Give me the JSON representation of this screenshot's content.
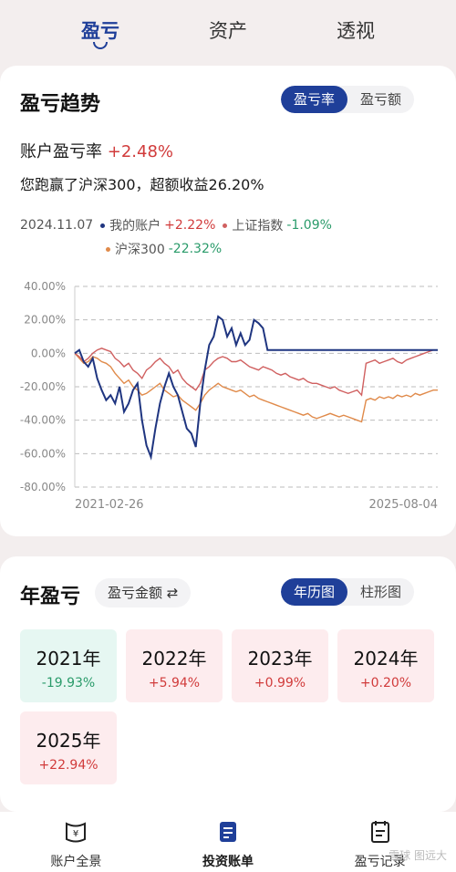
{
  "top_tabs": [
    {
      "label": "盈亏",
      "active": true
    },
    {
      "label": "资产",
      "active": false
    },
    {
      "label": "透视",
      "active": false
    }
  ],
  "trend": {
    "title": "盈亏趋势",
    "seg": [
      "盈亏率",
      "盈亏额"
    ],
    "account_label": "账户盈亏率",
    "account_value": "+2.48%",
    "beat_text": "您跑赢了沪深300，超额收益26.20%",
    "legend": {
      "date": "2024.11.07",
      "mine_label": "我的账户",
      "mine_value": "+2.22%",
      "sse_label": "上证指数",
      "sse_value": "-1.09%",
      "csi_label": "沪深300",
      "csi_value": "-22.32%"
    },
    "colors": {
      "mine": "#1f3580",
      "sse": "#d06060",
      "csi": "#e08a4a",
      "red": "#d13b3b",
      "green": "#2a9b6a"
    }
  },
  "chart_data": {
    "type": "line",
    "x_start_label": "2021-02-26",
    "x_end_label": "2025-08-04",
    "y_ticks": [
      "40.00%",
      "20.00%",
      "0.00%",
      "-20.00%",
      "-40.00%",
      "-60.00%",
      "-80.00%"
    ],
    "ylim": [
      -80,
      40
    ],
    "grid": true,
    "series": [
      {
        "name": "我的账户",
        "values": [
          0,
          2,
          -5,
          -8,
          -3,
          -15,
          -22,
          -28,
          -25,
          -30,
          -20,
          -35,
          -30,
          -22,
          -18,
          -40,
          -55,
          -62,
          -45,
          -30,
          -20,
          -12,
          -20,
          -25,
          -35,
          -45,
          -48,
          -56,
          -30,
          -10,
          5,
          10,
          22,
          20,
          10,
          15,
          5,
          12,
          5,
          8,
          20,
          18,
          15,
          2,
          2,
          2,
          2,
          2,
          2,
          2,
          2,
          2,
          2,
          2,
          2,
          2,
          2,
          2,
          2,
          2,
          2,
          2,
          2,
          2,
          2,
          2,
          2,
          2,
          2,
          2,
          2,
          2,
          2,
          2,
          2,
          2,
          2,
          2,
          2,
          2,
          2,
          2
        ]
      },
      {
        "name": "上证指数",
        "values": [
          0,
          -2,
          -5,
          -3,
          0,
          2,
          3,
          2,
          1,
          -3,
          -5,
          -8,
          -6,
          -10,
          -12,
          -15,
          -10,
          -8,
          -5,
          -3,
          -6,
          -8,
          -12,
          -10,
          -15,
          -18,
          -20,
          -22,
          -18,
          -10,
          -8,
          -5,
          -3,
          -2,
          -3,
          -5,
          -5,
          -4,
          -6,
          -8,
          -9,
          -10,
          -8,
          -9,
          -10,
          -12,
          -13,
          -12,
          -14,
          -15,
          -16,
          -15,
          -17,
          -18,
          -18,
          -19,
          -20,
          -21,
          -20,
          -22,
          -23,
          -24,
          -23,
          -22,
          -25,
          -6,
          -5,
          -4,
          -6,
          -5,
          -4,
          -3,
          -5,
          -6,
          -4,
          -3,
          -2,
          -1,
          0,
          1,
          2,
          2
        ]
      },
      {
        "name": "沪深300",
        "values": [
          0,
          -3,
          -6,
          -5,
          -2,
          -3,
          -5,
          -6,
          -8,
          -12,
          -15,
          -18,
          -16,
          -20,
          -22,
          -25,
          -24,
          -22,
          -20,
          -18,
          -22,
          -24,
          -26,
          -25,
          -28,
          -30,
          -32,
          -34,
          -30,
          -25,
          -22,
          -20,
          -18,
          -20,
          -21,
          -22,
          -23,
          -22,
          -24,
          -26,
          -25,
          -27,
          -28,
          -29,
          -30,
          -31,
          -32,
          -33,
          -34,
          -35,
          -36,
          -37,
          -36,
          -38,
          -39,
          -38,
          -37,
          -36,
          -37,
          -38,
          -37,
          -38,
          -39,
          -40,
          -41,
          -28,
          -27,
          -28,
          -26,
          -27,
          -26,
          -27,
          -25,
          -26,
          -25,
          -26,
          -24,
          -25,
          -24,
          -23,
          -22,
          -22
        ]
      }
    ]
  },
  "yearly": {
    "title": "年盈亏",
    "chip": "盈亏金额 ⇄",
    "seg": [
      "年历图",
      "柱形图"
    ],
    "years": [
      {
        "year": "2021年",
        "value": "-19.93%",
        "kind": "loss"
      },
      {
        "year": "2022年",
        "value": "+5.94%",
        "kind": "gain"
      },
      {
        "year": "2023年",
        "value": "+0.99%",
        "kind": "gain"
      },
      {
        "year": "2024年",
        "value": "+0.20%",
        "kind": "gain"
      },
      {
        "year": "2025年",
        "value": "+22.94%",
        "kind": "gain"
      }
    ]
  },
  "bottom_nav": [
    {
      "label": "账户全景",
      "icon": "wallet-icon",
      "active": false
    },
    {
      "label": "投资账单",
      "icon": "bill-icon",
      "active": true
    },
    {
      "label": "盈亏记录",
      "icon": "calendar-icon",
      "active": false
    }
  ],
  "watermark": "雪球 图远大"
}
